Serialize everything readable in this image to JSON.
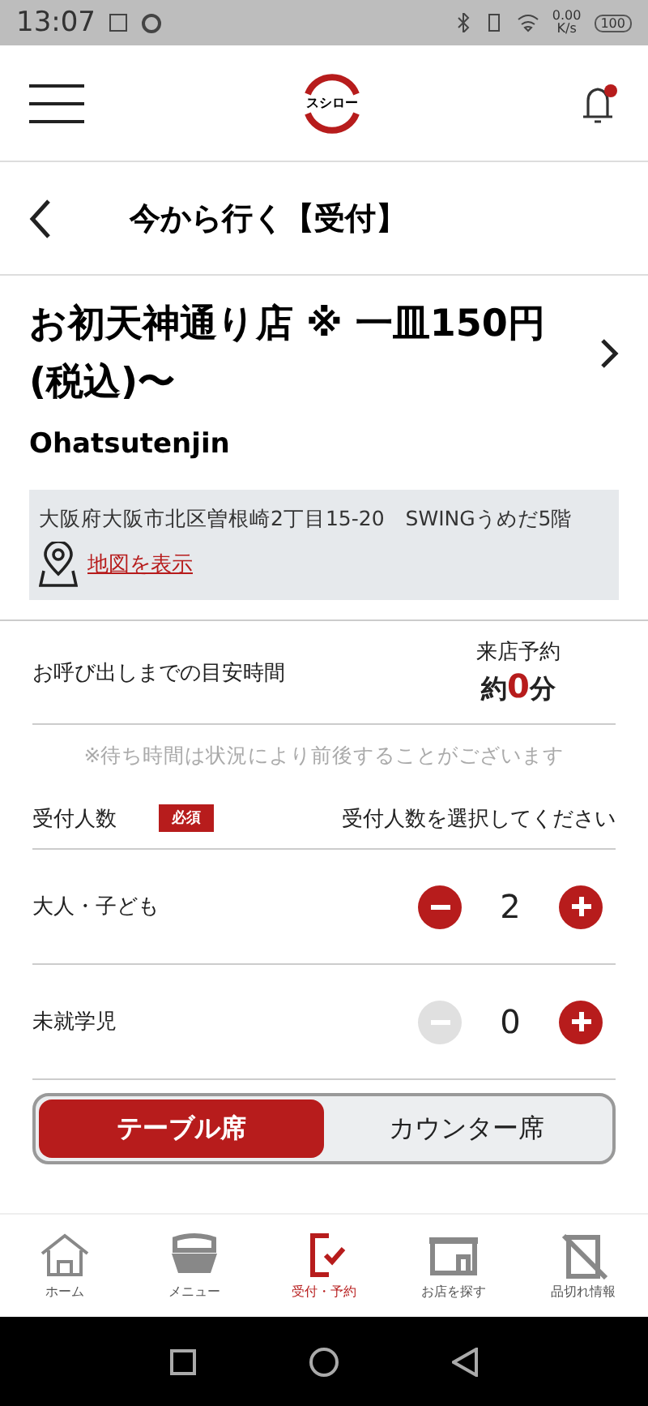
{
  "status_bar": {
    "time": "13:07",
    "speed": "0.00",
    "speed_unit": "K/s",
    "battery": "100"
  },
  "header": {
    "logo": "スシロー",
    "has_notification": true
  },
  "page_title": "今から行く【受付】",
  "store": {
    "name": "お初天神通り店 ※ 一皿150円(税込)〜",
    "romaji": "Ohatsutenjin",
    "address": "大阪府大阪市北区曽根崎2丁目15-20　SWINGうめだ5階",
    "map_link": "地図を表示"
  },
  "wait": {
    "label": "お呼び出しまでの目安時間",
    "type": "来店予約",
    "prefix": "約",
    "minutes": "0",
    "unit": "分",
    "note": "※待ち時間は状況により前後することがございます"
  },
  "party": {
    "label": "受付人数",
    "badge": "必須",
    "hint": "受付人数を選択してください"
  },
  "counters": [
    {
      "label": "大人・子ども",
      "value": "2",
      "minus_disabled": false
    },
    {
      "label": "未就学児",
      "value": "0",
      "minus_disabled": true
    }
  ],
  "seat_tabs": [
    {
      "label": "テーブル席",
      "selected": true
    },
    {
      "label": "カウンター席",
      "selected": false
    }
  ],
  "bottom_nav": [
    {
      "kind": "home",
      "label": "ホーム",
      "selected": false
    },
    {
      "kind": "menu",
      "label": "メニュー",
      "selected": false
    },
    {
      "kind": "reception",
      "label": "受付・予約",
      "selected": true
    },
    {
      "kind": "store",
      "label": "お店を探す",
      "selected": false
    },
    {
      "kind": "soldout",
      "label": "品切れ情報",
      "selected": false
    }
  ]
}
